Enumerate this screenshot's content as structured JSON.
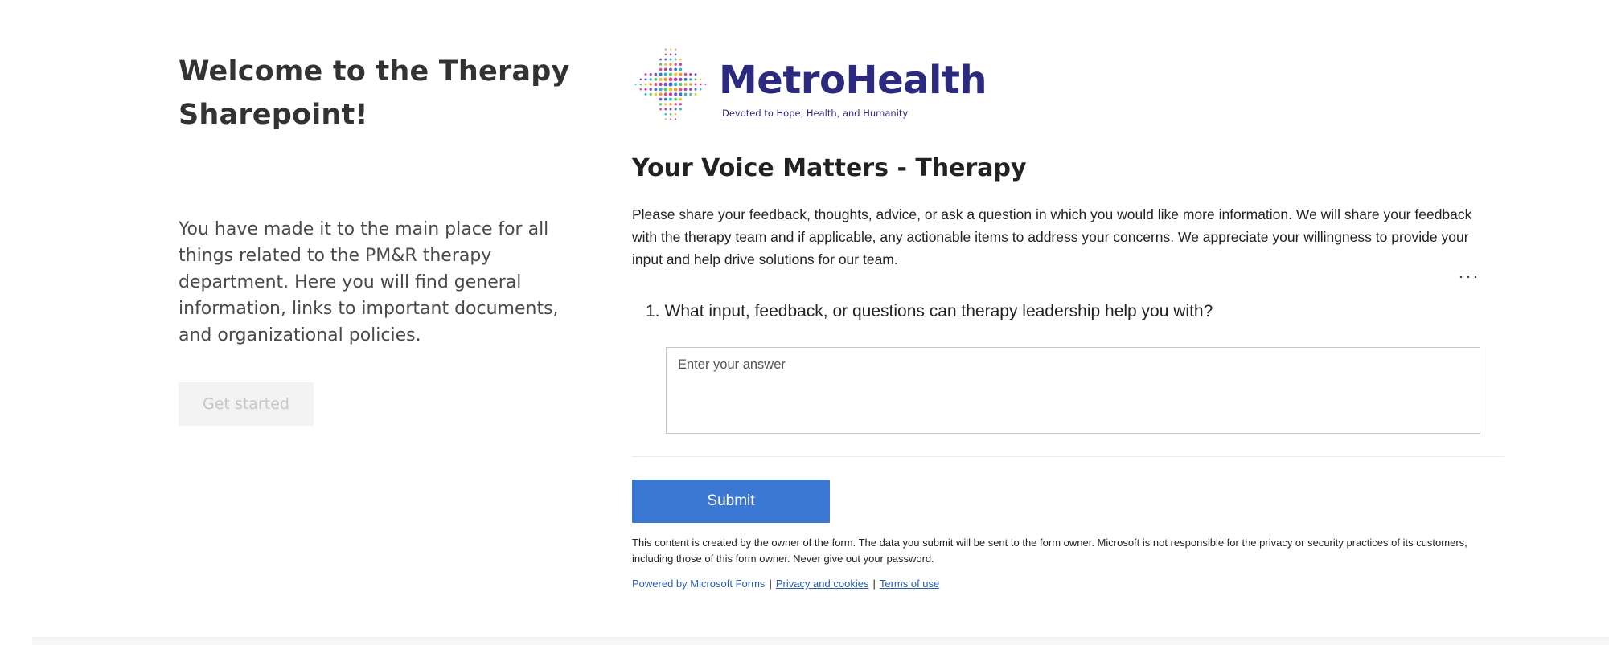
{
  "left": {
    "welcome_title": "Welcome to the Therapy Sharepoint!",
    "intro_text": "You have made it to the main place for all things related to the PM&R therapy department. Here you will find general information, links to important documents, and organizational policies.",
    "get_started_label": "Get started"
  },
  "logo": {
    "brand_name": "MetroHealth",
    "tagline": "Devoted to Hope, Health, and Humanity"
  },
  "form": {
    "title": "Your Voice Matters - Therapy",
    "description": "Please share your feedback, thoughts, advice, or ask a question in which you would like more information. We will share your feedback with the therapy team and if applicable, any actionable items to address your concerns. We appreciate your willingness to provide your input and help drive solutions for our team.",
    "more_options": "...",
    "question_number": "1.",
    "question_text": "What input, feedback, or questions can therapy leadership help you with?",
    "answer_placeholder": "Enter your answer",
    "submit_label": "Submit",
    "disclaimer": "This content is created by the owner of the form. The data you submit will be sent to the form owner. Microsoft is not responsible for the privacy or security practices of its customers, including those of this form owner. Never give out your password.",
    "powered_by": "Powered by Microsoft Forms",
    "separator": "|",
    "privacy_link": "Privacy and cookies",
    "terms_link": "Terms of use"
  },
  "colors": {
    "brand_navy": "#2c2a7f",
    "submit_blue": "#3a78d4",
    "link_blue": "#2a5fb0"
  }
}
